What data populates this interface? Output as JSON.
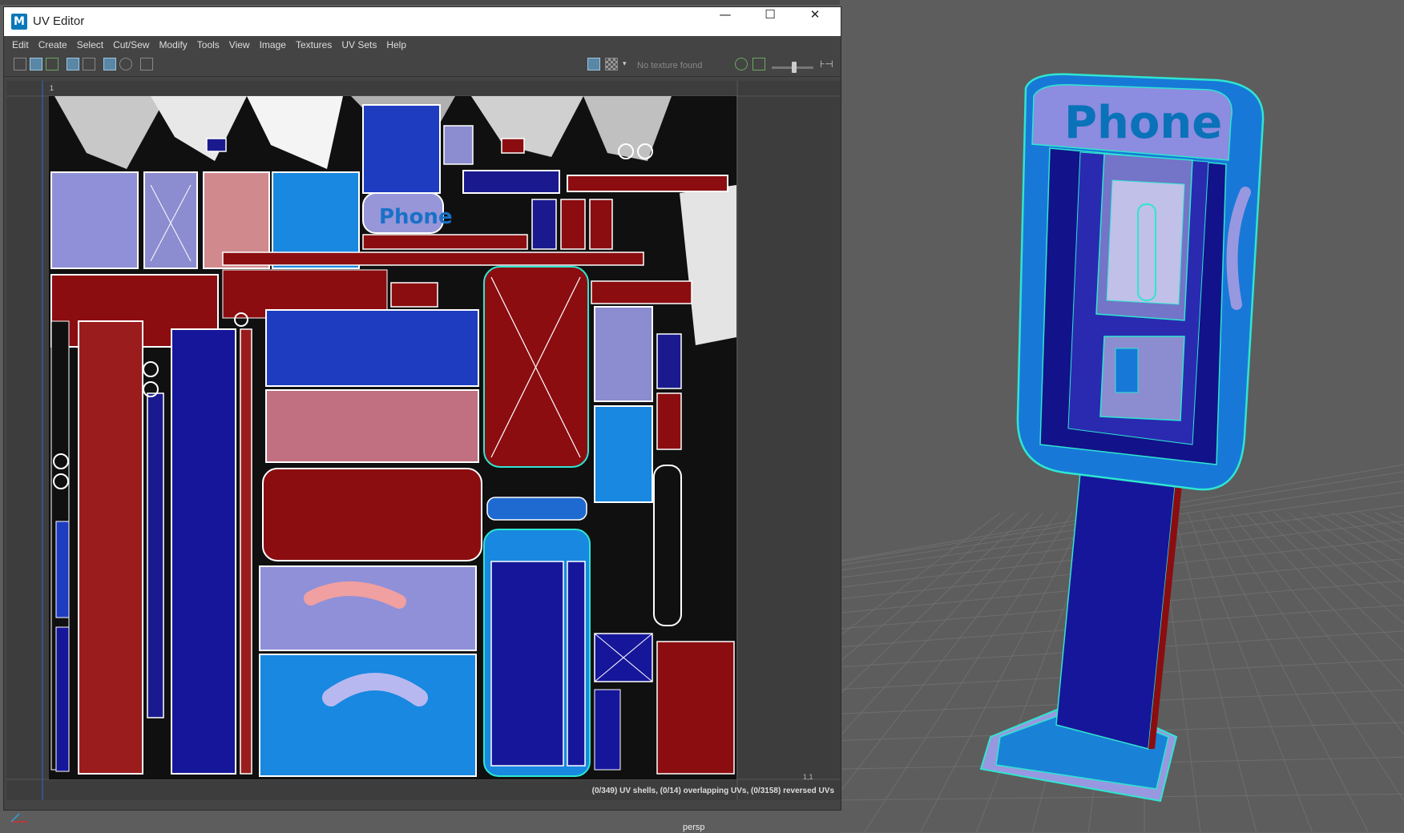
{
  "window": {
    "title": "UV Editor",
    "logo": "M",
    "controls": {
      "minimize": "—",
      "maximize": "☐",
      "close": "✕"
    }
  },
  "menu": [
    "Edit",
    "Create",
    "Select",
    "Cut/Sew",
    "Modify",
    "Tools",
    "View",
    "Image",
    "Textures",
    "UV Sets",
    "Help"
  ],
  "toolbar": {
    "texture_placeholder": "No texture found",
    "icons": [
      "uv-layout-icon",
      "uv-grid-icon",
      "uv-shaded-icon",
      "uv-frame-icon",
      "uv-frame-alt-icon",
      "grid-toggle-icon",
      "snapshot-icon",
      "camera-icon"
    ],
    "right_icons": [
      "image-display-icon",
      "checker-icon",
      "dropdown-icon",
      "texture-icon",
      "image-icon"
    ]
  },
  "uv": {
    "phone_label": "Phone",
    "corner_label": "1",
    "coord_label": "1,1",
    "status": "(0/349) UV shells, (0/14) overlapping UVs, (0/3158) reversed UVs"
  },
  "viewport": {
    "camera": "persp",
    "model_sign": "Phone"
  },
  "colors": {
    "accent": "#0a78b8",
    "uv_red": "#8b0d10",
    "uv_blue": "#1a1a8e",
    "uv_light_blue": "#1888e0",
    "uv_lavender": "#8c8cd0",
    "wire": "#2ee6d0"
  }
}
